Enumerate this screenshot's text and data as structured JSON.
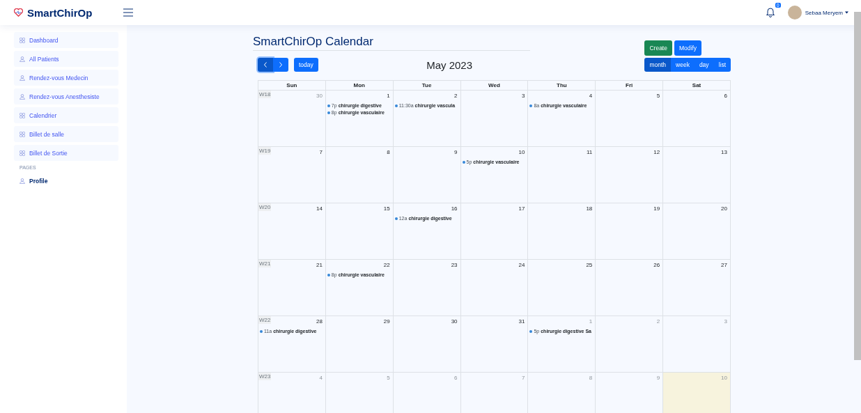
{
  "header": {
    "brand": "SmartChirOp",
    "notifications": "0",
    "user_name": "Sebaa Meryem"
  },
  "sidebar": {
    "items": [
      {
        "label": "Dashboard",
        "kind": "grid"
      },
      {
        "label": "All Patients",
        "kind": "person"
      },
      {
        "label": "Rendez-vous Medecin",
        "kind": "person"
      },
      {
        "label": "Rendez-vous Anesthesiste",
        "kind": "person"
      },
      {
        "label": "Calendrier",
        "kind": "grid"
      },
      {
        "label": "Billet de salle",
        "kind": "grid"
      },
      {
        "label": "Billet de Sortie",
        "kind": "grid"
      }
    ],
    "section": "PAGES",
    "pages": [
      {
        "label": "Profile",
        "kind": "person"
      }
    ]
  },
  "calendar": {
    "title": "SmartChirOp Calendar",
    "actions": [
      {
        "label": "Create",
        "kind": "success"
      },
      {
        "label": "Modify",
        "kind": "primary"
      }
    ],
    "today_button": "today",
    "month": "May 2023",
    "views": [
      {
        "label": "month",
        "selected": true
      },
      {
        "label": "week",
        "selected": false
      },
      {
        "label": "day",
        "selected": false
      },
      {
        "label": "list",
        "selected": false
      }
    ],
    "weekdays": [
      "Sun",
      "Mon",
      "Tue",
      "Wed",
      "Thu",
      "Fri",
      "Sat"
    ],
    "weeks": [
      {
        "label": "W18",
        "days": [
          {
            "date": "30",
            "other_month": true,
            "today": false
          },
          {
            "date": "1",
            "other_month": false,
            "today": false,
            "events": [
              {
                "time": "7p",
                "title": "chirurgie digestive"
              },
              {
                "time": "8p",
                "title": "chirurgie vasculaire"
              }
            ]
          },
          {
            "date": "2",
            "other_month": false,
            "today": false,
            "events": [
              {
                "time": "11:30a",
                "title": "chirurgie vascula"
              }
            ]
          },
          {
            "date": "3",
            "other_month": false,
            "today": false
          },
          {
            "date": "4",
            "other_month": false,
            "today": false,
            "events": [
              {
                "time": "8a",
                "title": "chirurgie vasculaire"
              }
            ]
          },
          {
            "date": "5",
            "other_month": false,
            "today": false
          },
          {
            "date": "6",
            "other_month": false,
            "today": false
          }
        ]
      },
      {
        "label": "W19",
        "days": [
          {
            "date": "7",
            "other_month": false,
            "today": false
          },
          {
            "date": "8",
            "other_month": false,
            "today": false
          },
          {
            "date": "9",
            "other_month": false,
            "today": false
          },
          {
            "date": "10",
            "other_month": false,
            "today": false,
            "events": [
              {
                "time": "5p",
                "title": "chirurgie vasculaire"
              }
            ]
          },
          {
            "date": "11",
            "other_month": false,
            "today": false
          },
          {
            "date": "12",
            "other_month": false,
            "today": false
          },
          {
            "date": "13",
            "other_month": false,
            "today": false
          }
        ]
      },
      {
        "label": "W20",
        "days": [
          {
            "date": "14",
            "other_month": false,
            "today": false
          },
          {
            "date": "15",
            "other_month": false,
            "today": false
          },
          {
            "date": "16",
            "other_month": false,
            "today": false,
            "events": [
              {
                "time": "12a",
                "title": "chirurgie digestive"
              }
            ]
          },
          {
            "date": "17",
            "other_month": false,
            "today": false
          },
          {
            "date": "18",
            "other_month": false,
            "today": false
          },
          {
            "date": "19",
            "other_month": false,
            "today": false
          },
          {
            "date": "20",
            "other_month": false,
            "today": false
          }
        ]
      },
      {
        "label": "W21",
        "days": [
          {
            "date": "21",
            "other_month": false,
            "today": false
          },
          {
            "date": "22",
            "other_month": false,
            "today": false,
            "events": [
              {
                "time": "8p",
                "title": "chirurgie vasculaire"
              }
            ]
          },
          {
            "date": "23",
            "other_month": false,
            "today": false
          },
          {
            "date": "24",
            "other_month": false,
            "today": false
          },
          {
            "date": "25",
            "other_month": false,
            "today": false
          },
          {
            "date": "26",
            "other_month": false,
            "today": false
          },
          {
            "date": "27",
            "other_month": false,
            "today": false
          }
        ]
      },
      {
        "label": "W22",
        "days": [
          {
            "date": "28",
            "other_month": false,
            "today": false,
            "events": [
              {
                "time": "11a",
                "title": "chirurgie digestive"
              }
            ]
          },
          {
            "date": "29",
            "other_month": false,
            "today": false
          },
          {
            "date": "30",
            "other_month": false,
            "today": false
          },
          {
            "date": "31",
            "other_month": false,
            "today": false
          },
          {
            "date": "1",
            "other_month": true,
            "today": false,
            "events": [
              {
                "time": "5p",
                "title": "chirurgie digestive Sa"
              }
            ]
          },
          {
            "date": "2",
            "other_month": true,
            "today": false
          },
          {
            "date": "3",
            "other_month": true,
            "today": false
          }
        ]
      },
      {
        "label": "W23",
        "days": [
          {
            "date": "4",
            "other_month": true,
            "today": false
          },
          {
            "date": "5",
            "other_month": true,
            "today": false
          },
          {
            "date": "6",
            "other_month": true,
            "today": false
          },
          {
            "date": "7",
            "other_month": true,
            "today": false
          },
          {
            "date": "8",
            "other_month": true,
            "today": false
          },
          {
            "date": "9",
            "other_month": true,
            "today": false
          },
          {
            "date": "10",
            "other_month": true,
            "today": true
          }
        ]
      }
    ]
  }
}
